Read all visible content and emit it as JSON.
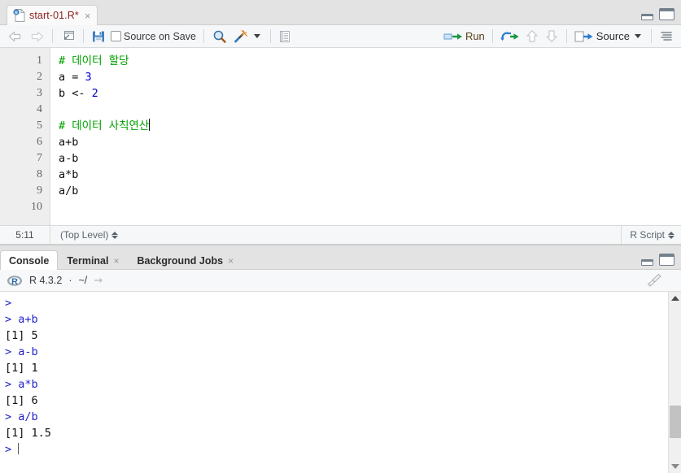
{
  "source_pane": {
    "tab": {
      "title": "start-01.R*",
      "icon": "r-document-icon",
      "close": "×"
    },
    "window_controls": {
      "minimize": "minimize-icon",
      "maximize": "maximize-icon"
    },
    "toolbar": {
      "back_icon": "back-arrow-icon",
      "forward_icon": "forward-arrow-icon",
      "popout_icon": "show-in-new-window-icon",
      "save_icon": "save-icon",
      "source_on_save_label": "Source on Save",
      "find_icon": "find-replace-icon",
      "codetools_icon": "code-tools-magic-wand-icon",
      "compile_report_icon": "compile-report-icon",
      "run_label": "Run",
      "rerun_icon": "rerun-previous-icon",
      "up_icon": "go-to-previous-chunk-icon",
      "down_icon": "go-to-next-chunk-icon",
      "source_label": "Source",
      "outline_icon": "document-outline-icon"
    },
    "editor": {
      "line_numbers": [
        "1",
        "2",
        "3",
        "4",
        "5",
        "6",
        "7",
        "8",
        "9",
        "10"
      ],
      "lines": [
        {
          "type": "comment",
          "text": "# 데이터 할당"
        },
        {
          "type": "assign",
          "lhs": "a = ",
          "value": "3"
        },
        {
          "type": "assign",
          "lhs": "b <- ",
          "value": "2"
        },
        {
          "type": "blank",
          "text": ""
        },
        {
          "type": "comment_caret",
          "text": "# 데이터 사칙연산"
        },
        {
          "type": "plain",
          "text": "a+b"
        },
        {
          "type": "plain",
          "text": "a-b"
        },
        {
          "type": "plain",
          "text": "a*b"
        },
        {
          "type": "plain",
          "text": "a/b"
        },
        {
          "type": "blank",
          "text": ""
        }
      ]
    },
    "status_bar": {
      "cursor_position": "5:11",
      "scope": "(Top Level)",
      "file_type": "R Script"
    }
  },
  "console_pane": {
    "tabs": [
      {
        "label": "Console",
        "closable": false,
        "active": true
      },
      {
        "label": "Terminal",
        "closable": true,
        "active": false
      },
      {
        "label": "Background Jobs",
        "closable": true,
        "active": false
      }
    ],
    "close_glyph": "×",
    "session": {
      "logo": "r-logo-icon",
      "version": "R 4.3.2",
      "separator": "·",
      "working_dir": "~/",
      "popout_icon": "view-in-new-window-icon"
    },
    "broom_icon": "clear-console-broom-icon",
    "window_controls": {
      "minimize": "minimize-icon",
      "maximize": "maximize-icon"
    },
    "output": [
      {
        "kind": "prompt",
        "prompt": "> ",
        "text": ""
      },
      {
        "kind": "input",
        "prompt": "> ",
        "text": "a+b"
      },
      {
        "kind": "result",
        "prompt": "",
        "text": "[1] 5"
      },
      {
        "kind": "input",
        "prompt": "> ",
        "text": "a-b"
      },
      {
        "kind": "result",
        "prompt": "",
        "text": "[1] 1"
      },
      {
        "kind": "input",
        "prompt": "> ",
        "text": "a*b"
      },
      {
        "kind": "result",
        "prompt": "",
        "text": "[1] 6"
      },
      {
        "kind": "input",
        "prompt": "> ",
        "text": "a/b"
      },
      {
        "kind": "result",
        "prompt": "",
        "text": "[1] 1.5"
      },
      {
        "kind": "cursor",
        "prompt": "> ",
        "text": ""
      }
    ],
    "scrollbar": {
      "up_icon": "scroll-up-arrow-icon",
      "down_icon": "scroll-down-arrow-icon"
    }
  },
  "colors": {
    "comment": "#00a000",
    "number": "#0000d0",
    "console_prompt": "#2222cc",
    "tab_title": "#8b2222",
    "run_label": "#5a3e1b",
    "green_arrow": "#1a9641",
    "blue_icon": "#2b7cd3"
  }
}
